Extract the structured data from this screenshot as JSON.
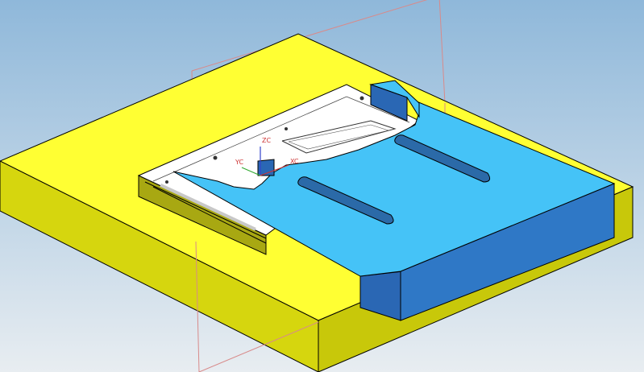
{
  "viewport": {
    "background_top": "#8fb8da",
    "background_bottom": "#e8edf1"
  },
  "colors": {
    "base_top": "#ffff33",
    "base_front": "#c8c80a",
    "base_side": "#a8a812",
    "base_left": "#d6d60e",
    "plate_top": "#45c3f7",
    "plate_front": "#2f78c6",
    "plate_side": "#2a67b4",
    "slot_fill": "#2b6aa8",
    "pocket_floor": "#ffffff",
    "datum_plane": "#d88a8a",
    "edge": "#000000",
    "x_axis": "#cc3333",
    "y_axis": "#33aa33",
    "z_axis": "#3344cc"
  },
  "csys": {
    "zc_label": "ZC",
    "yc_label": "YC",
    "xc_label": "XC"
  }
}
